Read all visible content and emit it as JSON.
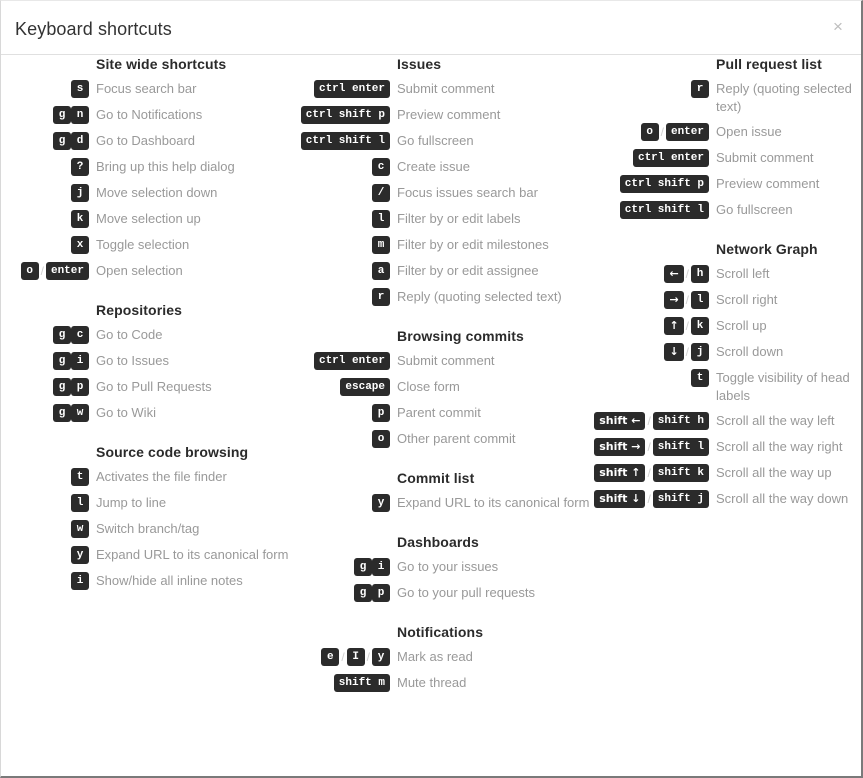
{
  "dialog": {
    "title": "Keyboard shortcuts",
    "close_label": "×",
    "close_icon": "close-icon",
    "separator": "/"
  },
  "colors": {
    "key_background": "#2b2b2b",
    "key_text": "#ffffff",
    "description_text": "#999999",
    "heading_text": "#2b2b2b",
    "title_text": "#333333",
    "border": "#e0e0e0",
    "close_icon": "#bdbdbd"
  },
  "columns": [
    {
      "id": "column-1",
      "sections": [
        {
          "heading": "Site wide shortcuts",
          "shortcuts": [
            {
              "keys": [
                "s"
              ],
              "description": "Focus search bar"
            },
            {
              "keys": [
                "g",
                "n"
              ],
              "description": "Go to Notifications"
            },
            {
              "keys": [
                "g",
                "d"
              ],
              "description": "Go to Dashboard"
            },
            {
              "keys": [
                "?"
              ],
              "description": "Bring up this help dialog"
            },
            {
              "keys": [
                "j"
              ],
              "description": "Move selection down"
            },
            {
              "keys": [
                "k"
              ],
              "description": "Move selection up"
            },
            {
              "keys": [
                "x"
              ],
              "description": "Toggle selection"
            },
            {
              "keys": [
                "o",
                "/",
                "enter"
              ],
              "description": "Open selection"
            }
          ]
        },
        {
          "heading": "Repositories",
          "shortcuts": [
            {
              "keys": [
                "g",
                "c"
              ],
              "description": "Go to Code"
            },
            {
              "keys": [
                "g",
                "i"
              ],
              "description": "Go to Issues"
            },
            {
              "keys": [
                "g",
                "p"
              ],
              "description": "Go to Pull Requests"
            },
            {
              "keys": [
                "g",
                "w"
              ],
              "description": "Go to Wiki"
            }
          ]
        },
        {
          "heading": "Source code browsing",
          "shortcuts": [
            {
              "keys": [
                "t"
              ],
              "description": "Activates the file finder"
            },
            {
              "keys": [
                "l"
              ],
              "description": "Jump to line"
            },
            {
              "keys": [
                "w"
              ],
              "description": "Switch branch/tag"
            },
            {
              "keys": [
                "y"
              ],
              "description": "Expand URL to its canonical form"
            },
            {
              "keys": [
                "i"
              ],
              "description": "Show/hide all inline notes"
            }
          ]
        }
      ]
    },
    {
      "id": "column-2",
      "sections": [
        {
          "heading": "Issues",
          "shortcuts": [
            {
              "keys": [
                "ctrl enter"
              ],
              "description": "Submit comment"
            },
            {
              "keys": [
                "ctrl shift p"
              ],
              "description": "Preview comment"
            },
            {
              "keys": [
                "ctrl shift l"
              ],
              "description": "Go fullscreen"
            },
            {
              "keys": [
                "c"
              ],
              "description": "Create issue"
            },
            {
              "keys": [
                "/"
              ],
              "description": "Focus issues search bar",
              "key_is_slash": true
            },
            {
              "keys": [
                "l"
              ],
              "description": "Filter by or edit labels"
            },
            {
              "keys": [
                "m"
              ],
              "description": "Filter by or edit milestones"
            },
            {
              "keys": [
                "a"
              ],
              "description": "Filter by or edit assignee"
            },
            {
              "keys": [
                "r"
              ],
              "description": "Reply (quoting selected text)"
            }
          ]
        },
        {
          "heading": "Browsing commits",
          "shortcuts": [
            {
              "keys": [
                "ctrl enter"
              ],
              "description": "Submit comment"
            },
            {
              "keys": [
                "escape"
              ],
              "description": "Close form"
            },
            {
              "keys": [
                "p"
              ],
              "description": "Parent commit"
            },
            {
              "keys": [
                "o"
              ],
              "description": "Other parent commit"
            }
          ]
        },
        {
          "heading": "Commit list",
          "shortcuts": [
            {
              "keys": [
                "y"
              ],
              "description": "Expand URL to its canonical form"
            }
          ]
        },
        {
          "heading": "Dashboards",
          "shortcuts": [
            {
              "keys": [
                "g",
                "i"
              ],
              "description": "Go to your issues"
            },
            {
              "keys": [
                "g",
                "p"
              ],
              "description": "Go to your pull requests"
            }
          ]
        },
        {
          "heading": "Notifications",
          "shortcuts": [
            {
              "keys": [
                "e",
                "/",
                "I",
                "/",
                "y"
              ],
              "description": "Mark as read"
            },
            {
              "keys": [
                "shift m"
              ],
              "description": "Mute thread"
            }
          ]
        }
      ]
    },
    {
      "id": "column-3",
      "sections": [
        {
          "heading": "Pull request list",
          "shortcuts": [
            {
              "keys": [
                "r"
              ],
              "description": "Reply (quoting selected text)"
            },
            {
              "keys": [
                "o",
                "/",
                "enter"
              ],
              "description": "Open issue"
            },
            {
              "keys": [
                "ctrl enter"
              ],
              "description": "Submit comment"
            },
            {
              "keys": [
                "ctrl shift p"
              ],
              "description": "Preview comment"
            },
            {
              "keys": [
                "ctrl shift l"
              ],
              "description": "Go fullscreen"
            }
          ]
        },
        {
          "heading": "Network Graph",
          "shortcuts": [
            {
              "keys": [
                "←",
                "/",
                "h"
              ],
              "description": "Scroll left"
            },
            {
              "keys": [
                "→",
                "/",
                "l"
              ],
              "description": "Scroll right"
            },
            {
              "keys": [
                "↑",
                "/",
                "k"
              ],
              "description": "Scroll up"
            },
            {
              "keys": [
                "↓",
                "/",
                "j"
              ],
              "description": "Scroll down"
            },
            {
              "keys": [
                "t"
              ],
              "description": "Toggle visibility of head labels"
            },
            {
              "keys": [
                "shift ←",
                "/",
                "shift h"
              ],
              "description": "Scroll all the way left"
            },
            {
              "keys": [
                "shift →",
                "/",
                "shift l"
              ],
              "description": "Scroll all the way right"
            },
            {
              "keys": [
                "shift ↑",
                "/",
                "shift k"
              ],
              "description": "Scroll all the way up"
            },
            {
              "keys": [
                "shift ↓",
                "/",
                "shift j"
              ],
              "description": "Scroll all the way down"
            }
          ]
        }
      ]
    }
  ]
}
